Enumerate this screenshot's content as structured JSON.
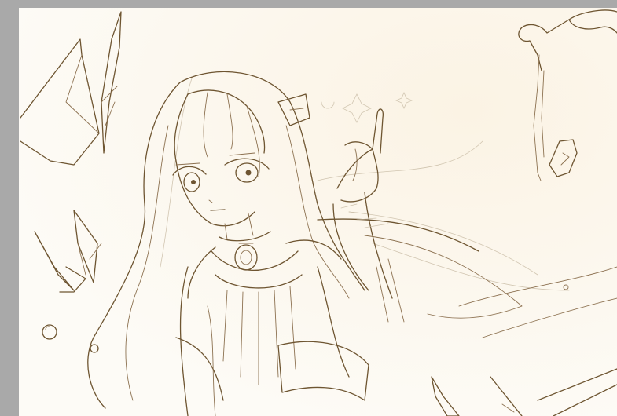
{
  "app": {
    "canvas_background": "#fdfbf6",
    "workspace_background": "#a9a9a9",
    "line_color": "#6e5531"
  },
  "artwork": {
    "medium": "pencil-sketch"
  }
}
